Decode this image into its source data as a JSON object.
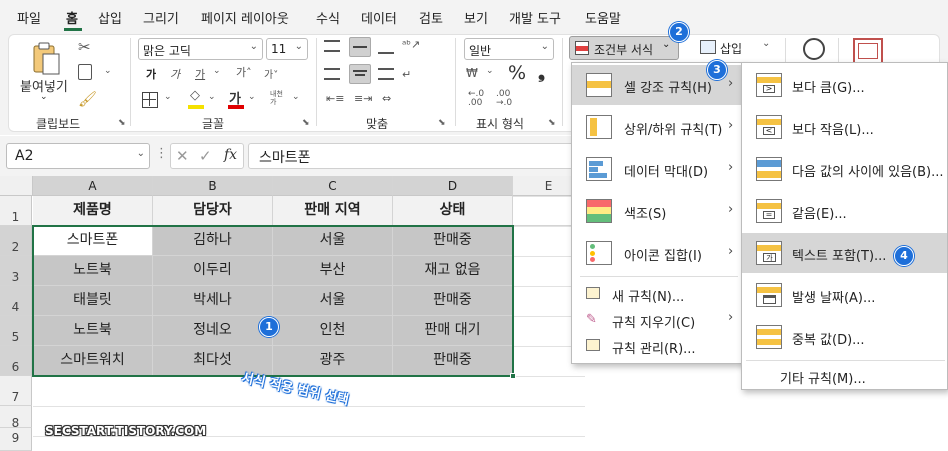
{
  "menu_tabs": [
    "파일",
    "홈",
    "삽입",
    "그리기",
    "페이지 레이아웃",
    "수식",
    "데이터",
    "검토",
    "보기",
    "개발 도구",
    "도움말"
  ],
  "active_tab": "홈",
  "ribbon": {
    "paste_label": "붙여넣기",
    "clipboard_label": "클립보드",
    "font_name": "맑은 고딕",
    "font_size": "11",
    "font_group_label": "글꼴",
    "align_group_label": "맞춤",
    "number_format": "일반",
    "number_group_label": "표시 형식",
    "percent_symbol": "%",
    "cond_format_label": "조건부 서식",
    "insert_label": "삽입"
  },
  "formula_bar": {
    "name_box": "A2",
    "fx": "fx",
    "content": "스마트폰"
  },
  "columns": [
    "A",
    "B",
    "C",
    "D",
    "E"
  ],
  "rows": [
    "1",
    "2",
    "3",
    "4",
    "5",
    "6",
    "7",
    "8",
    "9"
  ],
  "table": {
    "headers": [
      "제품명",
      "담당자",
      "판매 지역",
      "상태"
    ],
    "rows": [
      [
        "스마트폰",
        "김하나",
        "서울",
        "판매중"
      ],
      [
        "노트북",
        "이두리",
        "부산",
        "재고 없음"
      ],
      [
        "태블릿",
        "박세나",
        "서울",
        "판매중"
      ],
      [
        "노트북",
        "정네오",
        "인천",
        "판매 대기"
      ],
      [
        "스마트워치",
        "최다섯",
        "광주",
        "판매중"
      ]
    ]
  },
  "cf_menu": {
    "items": [
      {
        "label": "셀 강조 규칙(H)",
        "icon": "highlight-rules-icon"
      },
      {
        "label": "상위/하위 규칙(T)",
        "icon": "top-bottom-rules-icon"
      },
      {
        "label": "데이터 막대(D)",
        "icon": "data-bars-icon"
      },
      {
        "label": "색조(S)",
        "icon": "color-scales-icon"
      },
      {
        "label": "아이콘 집합(I)",
        "icon": "icon-sets-icon"
      }
    ],
    "small_items": [
      {
        "label": "새 규칙(N)...",
        "icon": "new-rule-icon"
      },
      {
        "label": "규칙 지우기(C)",
        "icon": "clear-rules-icon"
      },
      {
        "label": "규칙 관리(R)...",
        "icon": "manage-rules-icon"
      }
    ]
  },
  "sub_menu": {
    "items": [
      {
        "label": "보다 큼(G)...",
        "icon": "greater-than-icon"
      },
      {
        "label": "보다 작음(L)...",
        "icon": "less-than-icon"
      },
      {
        "label": "다음 값의 사이에 있음(B)...",
        "icon": "between-icon"
      },
      {
        "label": "같음(E)...",
        "icon": "equal-to-icon"
      },
      {
        "label": "텍스트 포함(T)...",
        "icon": "text-contains-icon"
      },
      {
        "label": "발생 날짜(A)...",
        "icon": "date-occurring-icon"
      },
      {
        "label": "중복 값(D)...",
        "icon": "duplicate-values-icon"
      }
    ],
    "more": "기타 규칙(M)..."
  },
  "annotations": {
    "badge1": "1",
    "badge2": "2",
    "badge3": "3",
    "badge4": "4",
    "range_note": "서식 적용 범위 선택",
    "watermark": "SECSTART.TISTORY.COM"
  },
  "colors": {
    "accent": "#217346",
    "badge": "#1e6fd9",
    "selection": "#c6c6c6"
  }
}
